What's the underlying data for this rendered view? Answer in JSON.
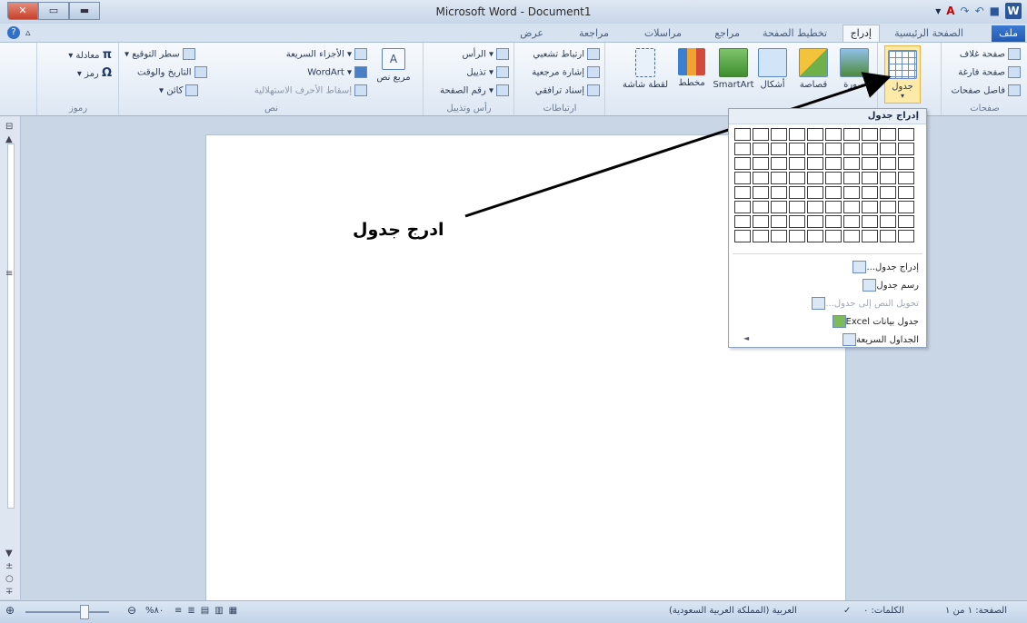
{
  "window": {
    "title": "Microsoft Word - Document1"
  },
  "tabs": {
    "file": "ملف",
    "home": "الصفحة الرئيسية",
    "insert": "إدراج",
    "layout": "تخطيط الصفحة",
    "references": "مراجع",
    "mailings": "مراسلات",
    "review": "مراجعة",
    "view": "عرض"
  },
  "ribbon": {
    "pages": {
      "cover": "صفحة غلاف",
      "blank": "صفحة فارغة",
      "break": "فاصل صفحات",
      "label": "صفحات"
    },
    "tables": {
      "table": "جدول"
    },
    "illustrations": {
      "picture": "صورة",
      "clipart": "قصاصة",
      "shapes": "أشكال",
      "smartart": "SmartArt",
      "chart": "مخطط",
      "screenshot": "لقطة شاشة"
    },
    "links": {
      "hyperlink": "ارتباط تشعبي",
      "bookmark": "إشارة مرجعية",
      "crossref": "إسناد ترافقي",
      "label": "ارتباطات"
    },
    "header_footer": {
      "header": "الرأس",
      "footer": "تذييل",
      "page_number": "رقم الصفحة",
      "label": "رأس وتذييل"
    },
    "text": {
      "textbox": "مربع نص",
      "quickparts": "الأجزاء السريعة",
      "wordart": "WordArt",
      "dropcap": "إسقاط الأحرف الاستهلالية",
      "signature": "سطر التوقيع",
      "datetime": "التاريخ والوقت",
      "object": "كائن",
      "label": "نص"
    },
    "symbols": {
      "equation": "معادلة",
      "symbol": "رمز",
      "label": "رموز"
    }
  },
  "dropdown": {
    "title": "إدراج جدول",
    "items": [
      {
        "label": "إدراج جدول...",
        "disabled": false
      },
      {
        "label": "رسم جدول",
        "disabled": false
      },
      {
        "label": "تحويل النص إلى جدول...",
        "disabled": true
      },
      {
        "label": "جدول بيانات Excel",
        "disabled": false
      },
      {
        "label": "الجداول السريعة",
        "disabled": false
      }
    ]
  },
  "annotation": "ادرج جدول",
  "status": {
    "page": "الصفحة: ١ من ١",
    "words": "الكلمات: ٠",
    "language": "العربية (المملكة العربية السعودية)",
    "zoom": "%٨٠"
  }
}
